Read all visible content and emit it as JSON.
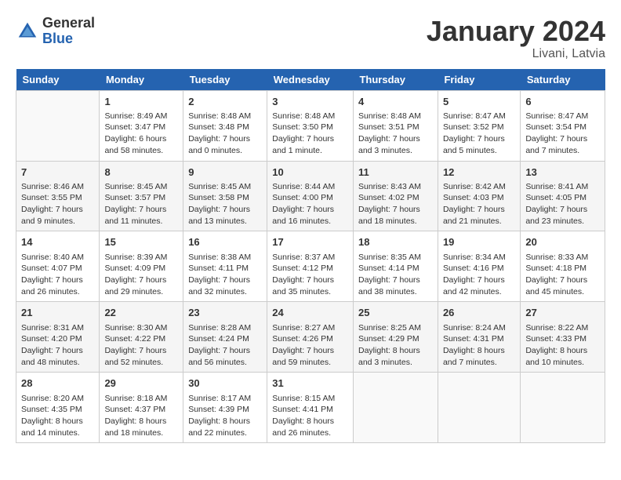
{
  "header": {
    "logo_general": "General",
    "logo_blue": "Blue",
    "month_title": "January 2024",
    "location": "Livani, Latvia"
  },
  "columns": [
    "Sunday",
    "Monday",
    "Tuesday",
    "Wednesday",
    "Thursday",
    "Friday",
    "Saturday"
  ],
  "weeks": [
    [
      {
        "day": "",
        "sunrise": "",
        "sunset": "",
        "daylight": ""
      },
      {
        "day": "1",
        "sunrise": "Sunrise: 8:49 AM",
        "sunset": "Sunset: 3:47 PM",
        "daylight": "Daylight: 6 hours and 58 minutes."
      },
      {
        "day": "2",
        "sunrise": "Sunrise: 8:48 AM",
        "sunset": "Sunset: 3:48 PM",
        "daylight": "Daylight: 7 hours and 0 minutes."
      },
      {
        "day": "3",
        "sunrise": "Sunrise: 8:48 AM",
        "sunset": "Sunset: 3:50 PM",
        "daylight": "Daylight: 7 hours and 1 minute."
      },
      {
        "day": "4",
        "sunrise": "Sunrise: 8:48 AM",
        "sunset": "Sunset: 3:51 PM",
        "daylight": "Daylight: 7 hours and 3 minutes."
      },
      {
        "day": "5",
        "sunrise": "Sunrise: 8:47 AM",
        "sunset": "Sunset: 3:52 PM",
        "daylight": "Daylight: 7 hours and 5 minutes."
      },
      {
        "day": "6",
        "sunrise": "Sunrise: 8:47 AM",
        "sunset": "Sunset: 3:54 PM",
        "daylight": "Daylight: 7 hours and 7 minutes."
      }
    ],
    [
      {
        "day": "7",
        "sunrise": "Sunrise: 8:46 AM",
        "sunset": "Sunset: 3:55 PM",
        "daylight": "Daylight: 7 hours and 9 minutes."
      },
      {
        "day": "8",
        "sunrise": "Sunrise: 8:45 AM",
        "sunset": "Sunset: 3:57 PM",
        "daylight": "Daylight: 7 hours and 11 minutes."
      },
      {
        "day": "9",
        "sunrise": "Sunrise: 8:45 AM",
        "sunset": "Sunset: 3:58 PM",
        "daylight": "Daylight: 7 hours and 13 minutes."
      },
      {
        "day": "10",
        "sunrise": "Sunrise: 8:44 AM",
        "sunset": "Sunset: 4:00 PM",
        "daylight": "Daylight: 7 hours and 16 minutes."
      },
      {
        "day": "11",
        "sunrise": "Sunrise: 8:43 AM",
        "sunset": "Sunset: 4:02 PM",
        "daylight": "Daylight: 7 hours and 18 minutes."
      },
      {
        "day": "12",
        "sunrise": "Sunrise: 8:42 AM",
        "sunset": "Sunset: 4:03 PM",
        "daylight": "Daylight: 7 hours and 21 minutes."
      },
      {
        "day": "13",
        "sunrise": "Sunrise: 8:41 AM",
        "sunset": "Sunset: 4:05 PM",
        "daylight": "Daylight: 7 hours and 23 minutes."
      }
    ],
    [
      {
        "day": "14",
        "sunrise": "Sunrise: 8:40 AM",
        "sunset": "Sunset: 4:07 PM",
        "daylight": "Daylight: 7 hours and 26 minutes."
      },
      {
        "day": "15",
        "sunrise": "Sunrise: 8:39 AM",
        "sunset": "Sunset: 4:09 PM",
        "daylight": "Daylight: 7 hours and 29 minutes."
      },
      {
        "day": "16",
        "sunrise": "Sunrise: 8:38 AM",
        "sunset": "Sunset: 4:11 PM",
        "daylight": "Daylight: 7 hours and 32 minutes."
      },
      {
        "day": "17",
        "sunrise": "Sunrise: 8:37 AM",
        "sunset": "Sunset: 4:12 PM",
        "daylight": "Daylight: 7 hours and 35 minutes."
      },
      {
        "day": "18",
        "sunrise": "Sunrise: 8:35 AM",
        "sunset": "Sunset: 4:14 PM",
        "daylight": "Daylight: 7 hours and 38 minutes."
      },
      {
        "day": "19",
        "sunrise": "Sunrise: 8:34 AM",
        "sunset": "Sunset: 4:16 PM",
        "daylight": "Daylight: 7 hours and 42 minutes."
      },
      {
        "day": "20",
        "sunrise": "Sunrise: 8:33 AM",
        "sunset": "Sunset: 4:18 PM",
        "daylight": "Daylight: 7 hours and 45 minutes."
      }
    ],
    [
      {
        "day": "21",
        "sunrise": "Sunrise: 8:31 AM",
        "sunset": "Sunset: 4:20 PM",
        "daylight": "Daylight: 7 hours and 48 minutes."
      },
      {
        "day": "22",
        "sunrise": "Sunrise: 8:30 AM",
        "sunset": "Sunset: 4:22 PM",
        "daylight": "Daylight: 7 hours and 52 minutes."
      },
      {
        "day": "23",
        "sunrise": "Sunrise: 8:28 AM",
        "sunset": "Sunset: 4:24 PM",
        "daylight": "Daylight: 7 hours and 56 minutes."
      },
      {
        "day": "24",
        "sunrise": "Sunrise: 8:27 AM",
        "sunset": "Sunset: 4:26 PM",
        "daylight": "Daylight: 7 hours and 59 minutes."
      },
      {
        "day": "25",
        "sunrise": "Sunrise: 8:25 AM",
        "sunset": "Sunset: 4:29 PM",
        "daylight": "Daylight: 8 hours and 3 minutes."
      },
      {
        "day": "26",
        "sunrise": "Sunrise: 8:24 AM",
        "sunset": "Sunset: 4:31 PM",
        "daylight": "Daylight: 8 hours and 7 minutes."
      },
      {
        "day": "27",
        "sunrise": "Sunrise: 8:22 AM",
        "sunset": "Sunset: 4:33 PM",
        "daylight": "Daylight: 8 hours and 10 minutes."
      }
    ],
    [
      {
        "day": "28",
        "sunrise": "Sunrise: 8:20 AM",
        "sunset": "Sunset: 4:35 PM",
        "daylight": "Daylight: 8 hours and 14 minutes."
      },
      {
        "day": "29",
        "sunrise": "Sunrise: 8:18 AM",
        "sunset": "Sunset: 4:37 PM",
        "daylight": "Daylight: 8 hours and 18 minutes."
      },
      {
        "day": "30",
        "sunrise": "Sunrise: 8:17 AM",
        "sunset": "Sunset: 4:39 PM",
        "daylight": "Daylight: 8 hours and 22 minutes."
      },
      {
        "day": "31",
        "sunrise": "Sunrise: 8:15 AM",
        "sunset": "Sunset: 4:41 PM",
        "daylight": "Daylight: 8 hours and 26 minutes."
      },
      {
        "day": "",
        "sunrise": "",
        "sunset": "",
        "daylight": ""
      },
      {
        "day": "",
        "sunrise": "",
        "sunset": "",
        "daylight": ""
      },
      {
        "day": "",
        "sunrise": "",
        "sunset": "",
        "daylight": ""
      }
    ]
  ]
}
